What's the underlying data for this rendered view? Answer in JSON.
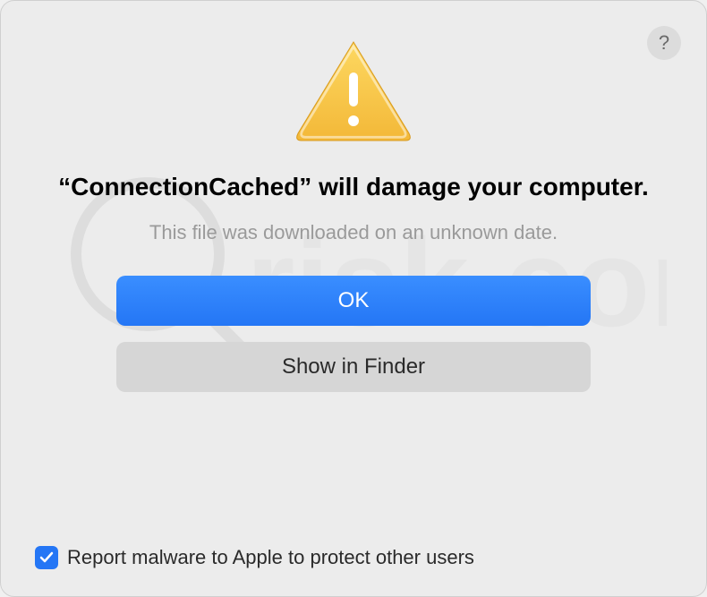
{
  "dialog": {
    "title": "“ConnectionCached” will damage your computer.",
    "subtitle": "This file was downloaded on an unknown date.",
    "buttons": {
      "primary": "OK",
      "secondary": "Show in Finder"
    },
    "checkbox": {
      "label": "Report malware to Apple to protect other users",
      "checked": true
    },
    "help": "?"
  }
}
